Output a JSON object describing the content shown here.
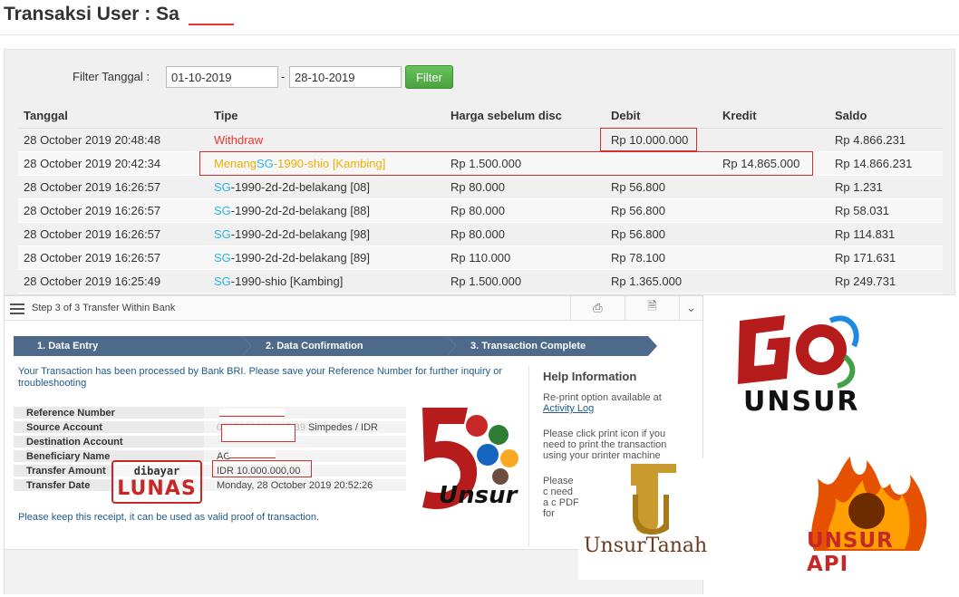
{
  "page": {
    "title": "Transaksi User : Sa"
  },
  "filter": {
    "label": "Filter Tanggal :",
    "from": "01-10-2019",
    "separator": "-",
    "to": "28-10-2019",
    "button": "Filter"
  },
  "table": {
    "headers": [
      "Tanggal",
      "Tipe",
      "Harga sebelum disc",
      "Debit",
      "Kredit",
      "Saldo"
    ],
    "rows": [
      {
        "tanggal": "28 October 2019 20:48:48",
        "tipe_a": "Withdraw",
        "tipe_b": "",
        "tipe_c": "",
        "harga": "",
        "debit": "Rp 10.000.000",
        "kredit": "",
        "saldo": "Rp 4.866.231"
      },
      {
        "tanggal": "28 October 2019 20:42:34",
        "tipe_a": "Menang",
        "tipe_b": "SG",
        "tipe_c": "-1990-shio [Kambing]",
        "harga": "Rp 1.500.000",
        "debit": "",
        "kredit": "Rp 14.865.000",
        "saldo": "Rp 14.866.231"
      },
      {
        "tanggal": "28 October 2019 16:26:57",
        "tipe_a": "",
        "tipe_b": "SG",
        "tipe_c": "-1990-2d-2d-belakang [08]",
        "harga": "Rp 80.000",
        "debit": "Rp 56.800",
        "kredit": "",
        "saldo": "Rp 1.231"
      },
      {
        "tanggal": "28 October 2019 16:26:57",
        "tipe_a": "",
        "tipe_b": "SG",
        "tipe_c": "-1990-2d-2d-belakang [88]",
        "harga": "Rp 80.000",
        "debit": "Rp 56.800",
        "kredit": "",
        "saldo": "Rp 58.031"
      },
      {
        "tanggal": "28 October 2019 16:26:57",
        "tipe_a": "",
        "tipe_b": "SG",
        "tipe_c": "-1990-2d-2d-belakang [98]",
        "harga": "Rp 80.000",
        "debit": "Rp 56.800",
        "kredit": "",
        "saldo": "Rp 114.831"
      },
      {
        "tanggal": "28 October 2019 16:26:57",
        "tipe_a": "",
        "tipe_b": "SG",
        "tipe_c": "-1990-2d-2d-belakang [89]",
        "harga": "Rp 110.000",
        "debit": "Rp 78.100",
        "kredit": "",
        "saldo": "Rp 171.631"
      },
      {
        "tanggal": "28 October 2019 16:25:49",
        "tipe_a": "",
        "tipe_b": "SG",
        "tipe_c": "-1990-shio [Kambing]",
        "harga": "Rp 1.500.000",
        "debit": "Rp 1.365.000",
        "kredit": "",
        "saldo": "Rp 249.731"
      }
    ]
  },
  "bank": {
    "header_title": "Step 3 of 3 Transfer Within Bank",
    "steps": [
      "1. Data Entry",
      "2. Data Confirmation",
      "3. Transaction Complete"
    ],
    "message": "Your Transaction has been processed by Bank BRI. Please save your Reference Number for further inquiry or troubleshooting",
    "details": [
      {
        "label": "Reference Number",
        "value": ""
      },
      {
        "label": "Source Account",
        "value": "Simpedes / IDR"
      },
      {
        "label": "Destination Account",
        "value": ""
      },
      {
        "label": "Beneficiary Name",
        "value": "AG"
      },
      {
        "label": "Transfer Amount",
        "value": "IDR 10.000.000,00"
      },
      {
        "label": "Transfer Date",
        "value": "Monday, 28 October 2019 20:52:26"
      }
    ],
    "note": "Please keep this receipt, it can be used as valid proof of transaction.",
    "help": {
      "title": "Help Information",
      "p1": "Re-print option available at",
      "p1_link": "Activity Log",
      "p2": "Please click print icon if you need to print the transaction using your printer machine",
      "p3": "Please c need a c PDF for"
    }
  },
  "stamp": {
    "small": "dibayar",
    "big": "LUNAS"
  },
  "logos": {
    "go_unsur": "UNSUR",
    "five_unsur": "Unsur",
    "unsur_tanah": "UnsurTanah",
    "unsur_api": "UNSUR API"
  },
  "colors": {
    "accent_green": "#5cb85c",
    "withdraw": "#e53935",
    "win": "#f0ad00",
    "sg": "#26b6ea",
    "step_bar": "#4e6a8a",
    "highlight": "#d32f2f"
  }
}
